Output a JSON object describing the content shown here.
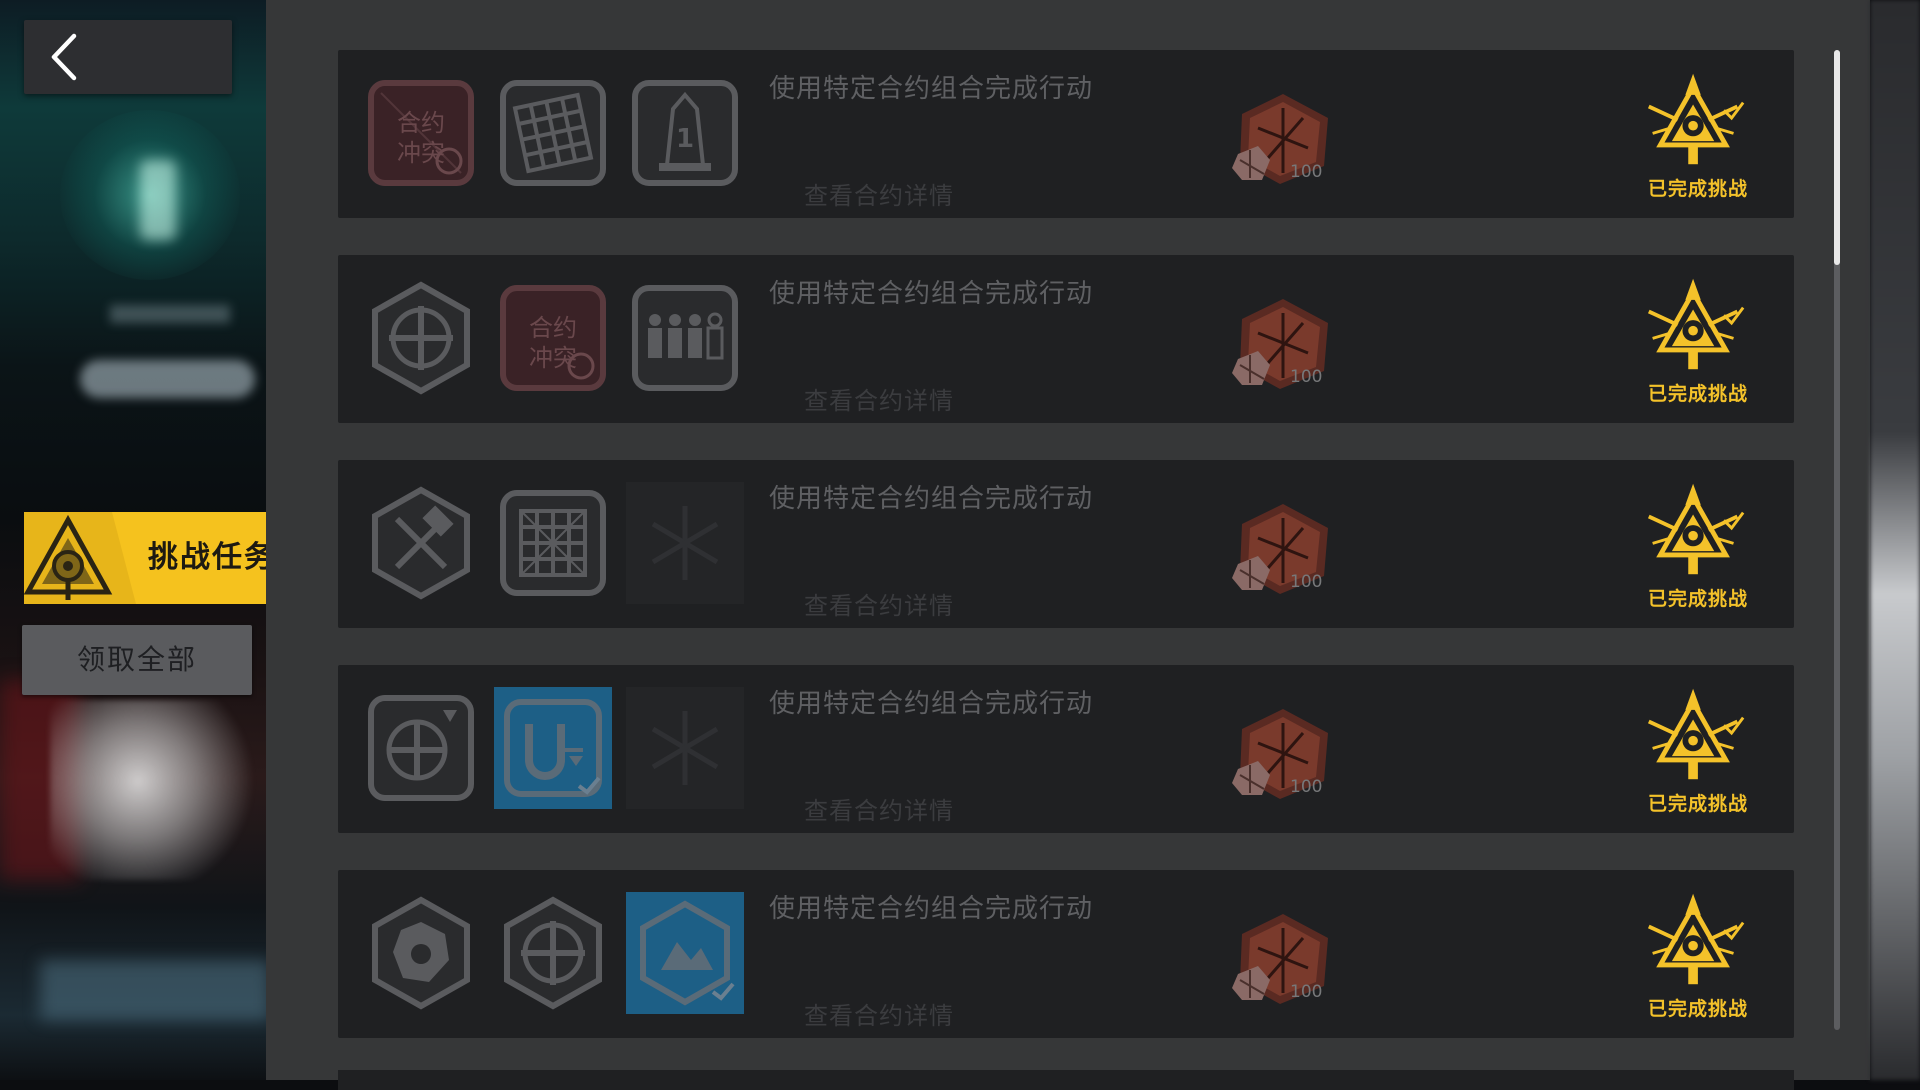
{
  "sidebar": {
    "back_icon": "chevron-left-icon",
    "challenge_tab": {
      "label": "挑战任务",
      "icon": "alert-triangle-emblem-icon",
      "accent": "#f5c21e"
    },
    "claim_all_label": "领取全部"
  },
  "tasks": [
    {
      "description": "使用特定合约组合完成行动",
      "detail_link": "查看合约详情",
      "reward_count": "100",
      "status": "已完成挑战",
      "slots": [
        "contract-clash-icon",
        "grid-icon",
        "tower-one-icon"
      ]
    },
    {
      "description": "使用特定合约组合完成行动",
      "detail_link": "查看合约详情",
      "reward_count": "100",
      "status": "已完成挑战",
      "slots": [
        "hex-cross-icon",
        "contract-clash-icon",
        "squad-icon"
      ]
    },
    {
      "description": "使用特定合约组合完成行动",
      "detail_link": "查看合约详情",
      "reward_count": "100",
      "status": "已完成挑战",
      "slots": [
        "hex-tools-icon",
        "grid-icon",
        "empty-slot-icon"
      ]
    },
    {
      "description": "使用特定合约组合完成行动",
      "detail_link": "查看合约详情",
      "reward_count": "100",
      "status": "已完成挑战",
      "slots": [
        "shield-cross-icon",
        "magnet-icon",
        "empty-slot-icon"
      ]
    },
    {
      "description": "使用特定合约组合完成行动",
      "detail_link": "查看合约详情",
      "reward_count": "100",
      "status": "已完成挑战",
      "slots": [
        "hex-burst-icon",
        "hex-cross-icon",
        "hex-terrain-icon"
      ]
    }
  ],
  "colors": {
    "accent": "#f5c21e",
    "card_bg": "#1f2022",
    "panel_bg": "#363738",
    "selected_slot": "#1d5f86"
  }
}
